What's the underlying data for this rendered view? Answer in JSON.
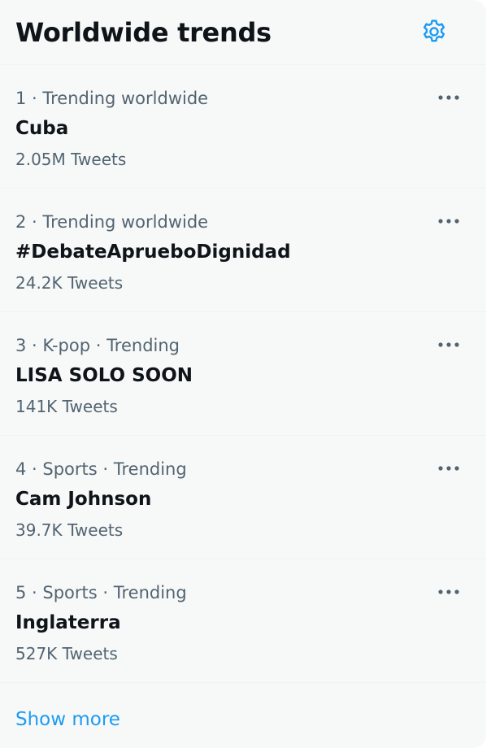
{
  "header": {
    "title": "Worldwide trends",
    "settings_icon": "gear-icon"
  },
  "trends": [
    {
      "meta": "1 · Trending worldwide",
      "name": "Cuba",
      "count": "2.05M Tweets"
    },
    {
      "meta": "2 · Trending worldwide",
      "name": "#DebateApruebo­Dignidad",
      "count": "24.2K Tweets"
    },
    {
      "meta": "3 · K-pop · Trending",
      "name": "LISA SOLO SOON",
      "count": "141K Tweets"
    },
    {
      "meta": "4 · Sports · Trending",
      "name": "Cam Johnson",
      "count": "39.7K Tweets"
    },
    {
      "meta": "5 · Sports · Trending",
      "name": "Inglaterra",
      "count": "527K Tweets"
    }
  ],
  "footer": {
    "show_more_label": "Show more"
  },
  "colors": {
    "accent": "#1d9bf0",
    "panel_background": "#f7f9f9",
    "primary_text": "#0f1419",
    "secondary_text": "#536471"
  },
  "icons": {
    "more": "more-horizontal-icon"
  }
}
